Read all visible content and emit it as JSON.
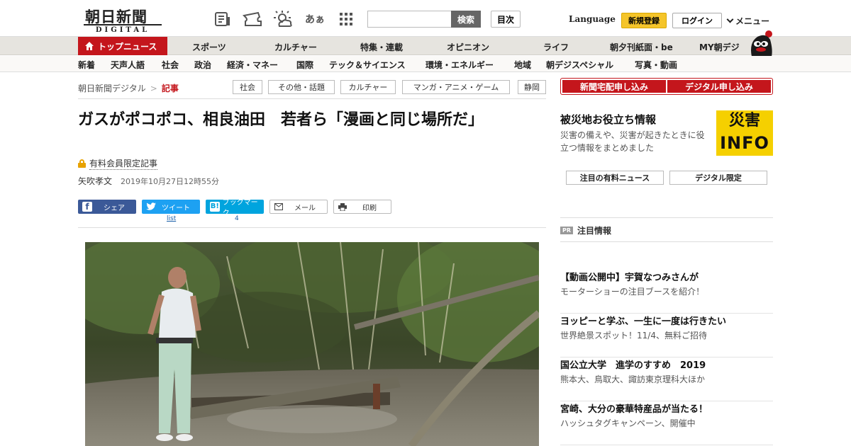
{
  "logo": {
    "main": "朝日新聞",
    "sub": "DIGITAL"
  },
  "header": {
    "icons": [
      "newspaper-icon",
      "ticket-icon",
      "weather-icon",
      "font-size-icon",
      "grid-icon"
    ],
    "font_size_label": "あぁ",
    "search_button": "検索",
    "toc_button": "目次",
    "language": "Language",
    "signup": "新規登録",
    "login": "ログイン",
    "menu": "メニュー"
  },
  "nav": {
    "top": "トップニュース",
    "items": [
      "スポーツ",
      "カルチャー",
      "特集・連載",
      "オピニオン",
      "ライフ",
      "朝夕刊紙面・be",
      "MY朝デジ"
    ]
  },
  "subnav": [
    "新着",
    "天声人語",
    "社会",
    "政治",
    "経済・マネー",
    "国際",
    "テック＆サイエンス",
    "環境・エネルギー",
    "地域",
    "朝デジスペシャル",
    "写真・動画"
  ],
  "breadcrumb": {
    "home": "朝日新聞デジタル",
    "current": "記事"
  },
  "tags": [
    "社会",
    "その他・話題",
    "カルチャー",
    "マンガ・アニメ・ゲーム",
    "静岡"
  ],
  "article": {
    "headline": "ガスがポコポコ、相良油田　若者ら「漫画と同じ場所だ」",
    "paid_label": "有料会員限定記事",
    "author": "矢吹孝文",
    "date": "2019年10月27日12時55分"
  },
  "share": {
    "facebook": "シェア",
    "twitter": "ツイート",
    "hatena": "ブックマーク",
    "mail": "メール",
    "print": "印刷",
    "twitter_count": "list",
    "hatena_count": "4"
  },
  "sidebar": {
    "subscribe_paper": "新聞宅配申し込み",
    "subscribe_digital": "デジタル申し込み",
    "disaster_title": "被災地お役立ち情報",
    "disaster_desc": "災害の備えや、災害が起きたときに役立つ情報をまとめました",
    "info_top": "災害",
    "info_bottom": "INFO",
    "btn_paid_news": "注目の有料ニュース",
    "btn_digital_only": "デジタル限定",
    "pr_badge": "PR",
    "pr_head": "注目情報",
    "ads": [
      {
        "title": "【動画公開中】宇賀なつみさんが",
        "sub": "モーターショーの注目ブースを紹介！"
      },
      {
        "title": "ヨッピーと学ぶ、一生に一度は行きたい",
        "sub": "世界絶景スポット！11/4、無料ご招待"
      },
      {
        "title": "国公立大学　進学のすすめ　2019",
        "sub": "熊本大、鳥取大、諏訪東京理科大ほか"
      },
      {
        "title": "宮崎、大分の豪華特産品が当たる！",
        "sub": "ハッシュタグキャンペーン、開催中"
      }
    ]
  },
  "colors": {
    "brand_red": "#c4161c",
    "signup_yellow": "#f5c52a",
    "info_yellow": "#f5d000"
  }
}
